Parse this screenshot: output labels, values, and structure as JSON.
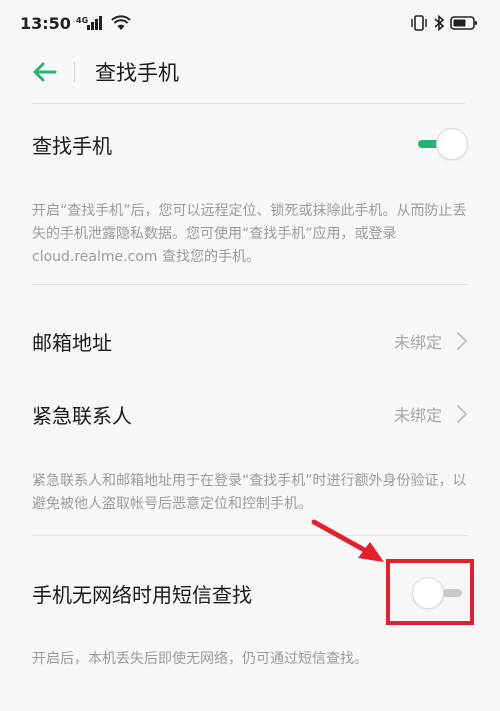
{
  "status_bar": {
    "time": "13:50",
    "network": "4G",
    "icons": [
      "vibrate-icon",
      "bluetooth-icon",
      "battery-icon"
    ]
  },
  "header": {
    "title": "查找手机",
    "back_icon": "back-arrow-icon"
  },
  "find_phone": {
    "label": "查找手机",
    "toggle_on": true,
    "description": "开启“查找手机”后，您可以远程定位、锁死或抹除此手机。从而防止丢失的手机泄露隐私数据。您可使用“查找手机”应用，或登录 cloud.realme.com 查找您的手机。"
  },
  "email": {
    "label": "邮箱地址",
    "value": "未绑定"
  },
  "emergency": {
    "label": "紧急联系人",
    "value": "未绑定",
    "description": "紧急联系人和邮箱地址用于在登录“查找手机”时进行额外身份验证，以避免被他人盗取帐号后恶意定位和控制手机。"
  },
  "sms_find": {
    "label": "手机无网络时用短信查找",
    "toggle_on": false,
    "description": "开启后，本机丢失后即使无网络，仍可通过短信查找。"
  },
  "colors": {
    "accent": "#22b573",
    "highlight": "#e5202e",
    "background": "#f7f7f7"
  }
}
